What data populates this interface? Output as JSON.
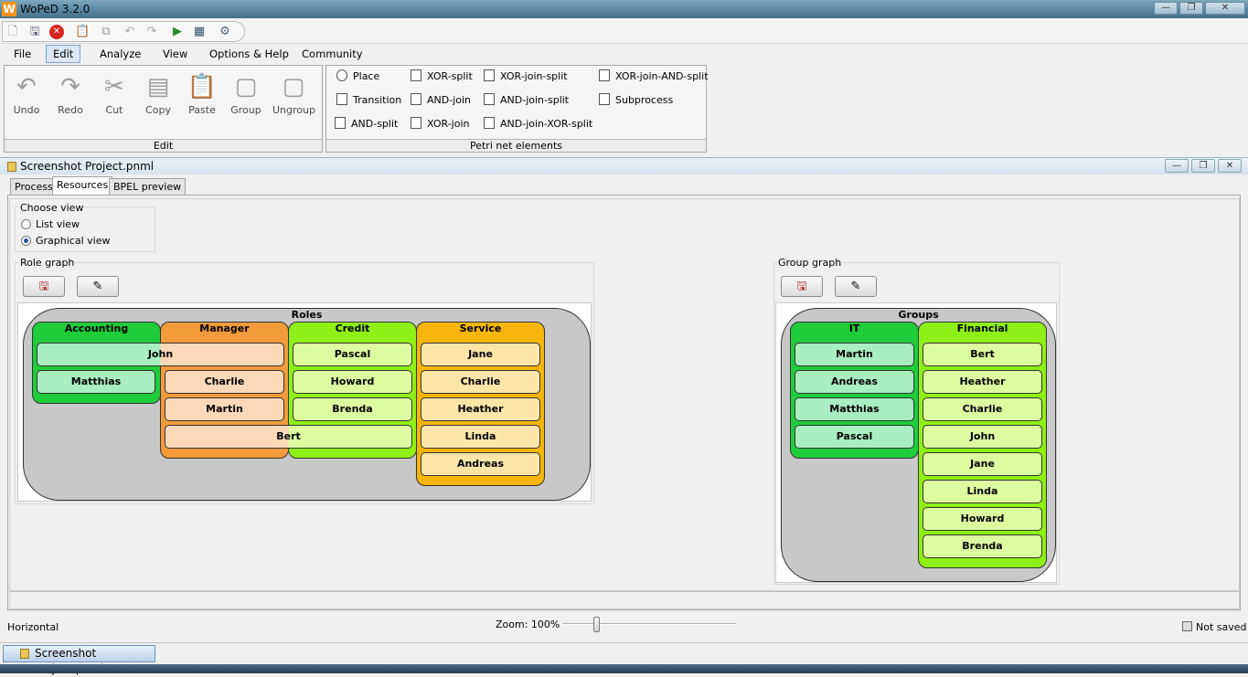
{
  "window": {
    "title": "WoPeD 3.2.0",
    "logo": "W"
  },
  "quick_toolbar": [
    "new-icon",
    "open-icon",
    "close-icon",
    "clipboard-icon",
    "copy-icon",
    "undo-icon",
    "redo-icon",
    "simulate-icon",
    "dashboard-icon",
    "settings-icon"
  ],
  "menu": [
    "File",
    "Edit",
    "Analyze",
    "View",
    "Options & Help",
    "Community"
  ],
  "ribbon": {
    "edit_buttons": [
      "Undo",
      "Redo",
      "Cut",
      "Copy",
      "Paste",
      "Group",
      "Ungroup"
    ],
    "edit_label": "Edit",
    "petri_items": [
      [
        "Place",
        "XOR-split",
        "XOR-join-split",
        "XOR-join-AND-split"
      ],
      [
        "Transition",
        "AND-join",
        "AND-join-split",
        "Subprocess"
      ],
      [
        "AND-split",
        "XOR-join",
        "AND-join-XOR-split"
      ]
    ],
    "petri_label": "Petri net elements"
  },
  "document": {
    "title": "Screenshot Project.pnml",
    "tabs": [
      "Process",
      "Resources",
      "BPEL preview"
    ],
    "active_tab": "Resources"
  },
  "choose_view": {
    "title": "Choose view",
    "options": [
      "List view",
      "Graphical view"
    ],
    "selected": "Graphical view"
  },
  "role_graph": {
    "title": "Role graph",
    "container": "Roles",
    "columns": [
      {
        "name": "Accounting",
        "color": "#1fcc3a",
        "members": [
          "Matthias"
        ]
      },
      {
        "name": "Manager",
        "color": "#f39a3a",
        "members": [
          "Charlie",
          "Martin"
        ]
      },
      {
        "name": "Credit",
        "color": "#8ef016",
        "members": [
          "Pascal",
          "Howard",
          "Brenda"
        ]
      },
      {
        "name": "Service",
        "color": "#f5b50b",
        "members": [
          "Jane",
          "Charlie",
          "Heather",
          "Linda",
          "Andreas"
        ]
      }
    ],
    "spanning": [
      {
        "name": "John",
        "spans": [
          "Accounting",
          "Manager"
        ]
      },
      {
        "name": "Bert",
        "spans": [
          "Manager",
          "Credit"
        ]
      }
    ]
  },
  "group_graph": {
    "title": "Group graph",
    "container": "Groups",
    "columns": [
      {
        "name": "IT",
        "color": "#1fcc3a",
        "members": [
          "Martin",
          "Andreas",
          "Matthias",
          "Pascal"
        ]
      },
      {
        "name": "Financial",
        "color": "#8ef016",
        "members": [
          "Bert",
          "Heather",
          "Charlie",
          "John",
          "Jane",
          "Linda",
          "Howard",
          "Brenda"
        ]
      }
    ]
  },
  "status": {
    "orientation": "Horizontal",
    "zoom_label": "Zoom: 100%",
    "zoom": 100,
    "saved_state": "Not saved"
  },
  "taskbar": {
    "item": "Screenshot Project.pnml"
  }
}
